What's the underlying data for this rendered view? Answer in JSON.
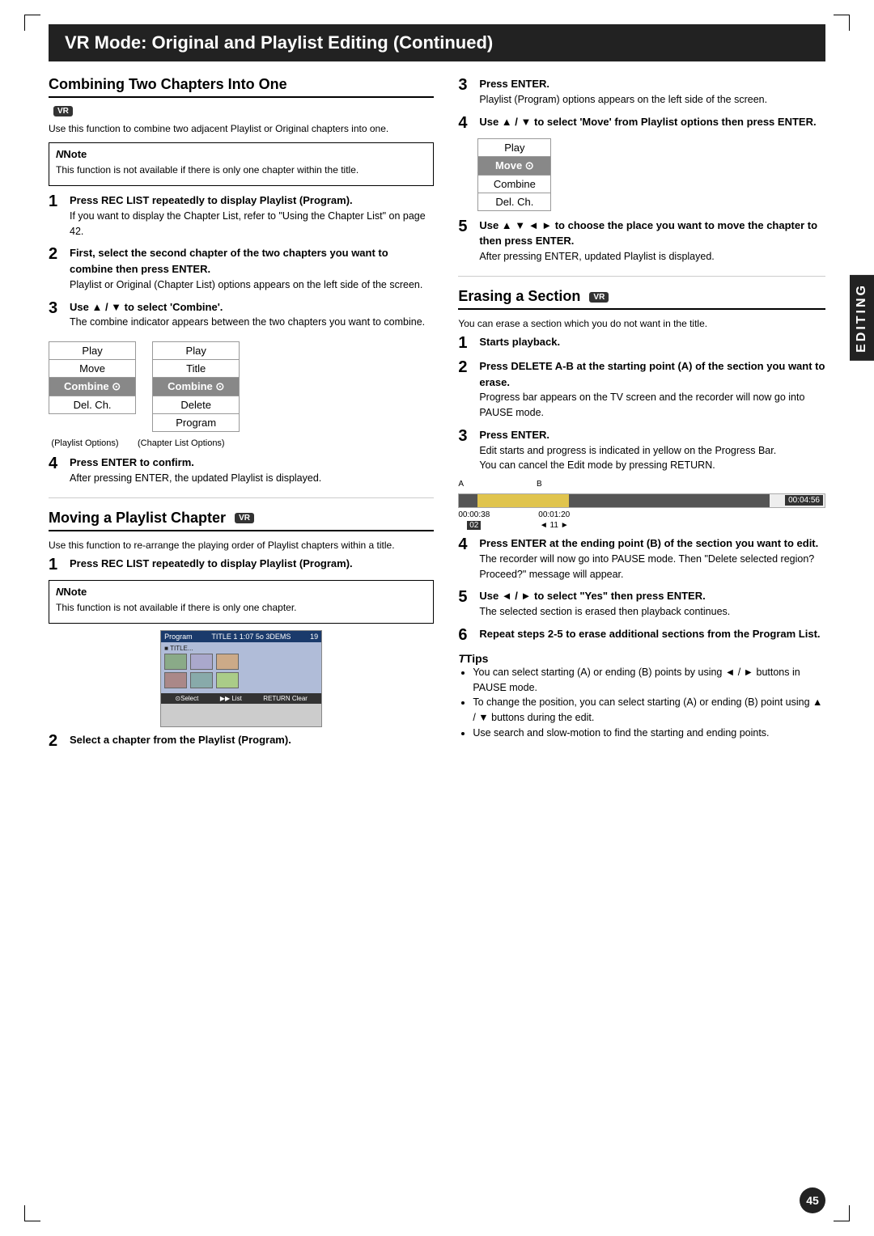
{
  "title": "VR Mode: Original and Playlist Editing (Continued)",
  "page_number": "45",
  "sections": {
    "combining": {
      "heading": "Combining Two Chapters Into One",
      "badge": "VR",
      "intro": "Use this function to combine two adjacent Playlist or Original chapters into one.",
      "note_title": "Note",
      "note_text": "This function is not available if there is only one chapter within the title.",
      "steps": [
        {
          "num": "1",
          "bold": "Press REC LIST repeatedly to display Playlist (Program).",
          "detail": "If you want to display the Chapter List, refer to \"Using the Chapter List\" on page 42."
        },
        {
          "num": "2",
          "bold": "First, select the second chapter of the two chapters you want to combine then press ENTER.",
          "detail": "Playlist or Original (Chapter List) options appears on the left side of the screen."
        },
        {
          "num": "3",
          "bold": "Use ▲ / ▼ to select 'Combine'.",
          "detail": "The combine indicator appears between the two chapters you want to combine."
        },
        {
          "num": "4",
          "bold": "Press ENTER to confirm.",
          "detail": "After pressing ENTER, the updated Playlist is displayed."
        }
      ],
      "playlist_menu": [
        "Play",
        "Move",
        "Combine ⊙",
        "Del. Ch."
      ],
      "chapter_menu": [
        "Play",
        "Title",
        "Combine ⊙",
        "Delete",
        "Program"
      ],
      "playlist_label": "(Playlist Options)",
      "chapter_label": "(Chapter List Options)"
    },
    "moving": {
      "heading": "Moving a Playlist Chapter",
      "badge": "VR",
      "intro": "Use this function to re-arrange the playing order of Playlist chapters within a title.",
      "steps": [
        {
          "num": "1",
          "bold": "Press REC LIST repeatedly to display Playlist (Program).",
          "detail": ""
        },
        {
          "num": "2",
          "bold": "Select a chapter from the Playlist (Program).",
          "detail": ""
        }
      ],
      "note_title": "Note",
      "note_text": "This function is not available if there is only one chapter."
    },
    "erasing": {
      "heading": "Erasing a Section",
      "badge": "VR",
      "intro": "You can erase a section which you do not want in the title.",
      "steps": [
        {
          "num": "1",
          "bold": "Starts playback.",
          "detail": ""
        },
        {
          "num": "2",
          "bold": "Press DELETE A-B at the starting point (A) of the section you want to erase.",
          "detail": "Progress bar appears on the TV screen and the recorder will now go into PAUSE mode."
        },
        {
          "num": "3",
          "bold": "Press ENTER.",
          "detail": "Edit starts and progress is indicated in yellow on the Progress Bar.\nYou can cancel the Edit mode by pressing RETURN."
        },
        {
          "num": "4",
          "bold": "Press ENTER at the ending point (B) of the section you want to edit.",
          "detail": "The recorder will now go into PAUSE mode. Then \"Delete selected region? Proceed?\" message will appear."
        },
        {
          "num": "5",
          "bold": "Use ◄ / ► to select \"Yes\" then press ENTER.",
          "detail": "The selected section is erased then playback continues."
        },
        {
          "num": "6",
          "bold": "Repeat steps 2-5 to erase additional sections from the Program List.",
          "detail": ""
        }
      ],
      "progress_time_total": "00:04:56",
      "progress_label_a": "A",
      "progress_label_b": "B",
      "progress_time_a": "00:00:38\n02",
      "progress_time_b": "00:01:20\n◄ 11 ►"
    },
    "moving_steps_continued": {
      "step3": {
        "bold": "Press ENTER.",
        "detail": "Playlist (Program) options appears on the left side of the screen."
      },
      "step4": {
        "bold": "Use ▲ / ▼ to select 'Move' from Playlist options then press ENTER.",
        "detail": ""
      },
      "step5": {
        "bold": "Use ▲ ▼ ◄ ► to choose the place you want to move the chapter to then press ENTER.",
        "detail": "After pressing ENTER, updated Playlist is displayed."
      },
      "move_menu": [
        "Play",
        "Move ⊙",
        "Combine",
        "Del. Ch."
      ]
    },
    "tips": {
      "title": "Tips",
      "items": [
        "You can select starting (A) or ending (B) points by using ◄ / ► buttons in PAUSE mode.",
        "To change the position, you can select starting (A) or ending (B) point using ▲ / ▼ buttons during the edit.",
        "Use search and slow-motion to find the starting and ending points."
      ]
    }
  },
  "editing_label": "EDITING"
}
